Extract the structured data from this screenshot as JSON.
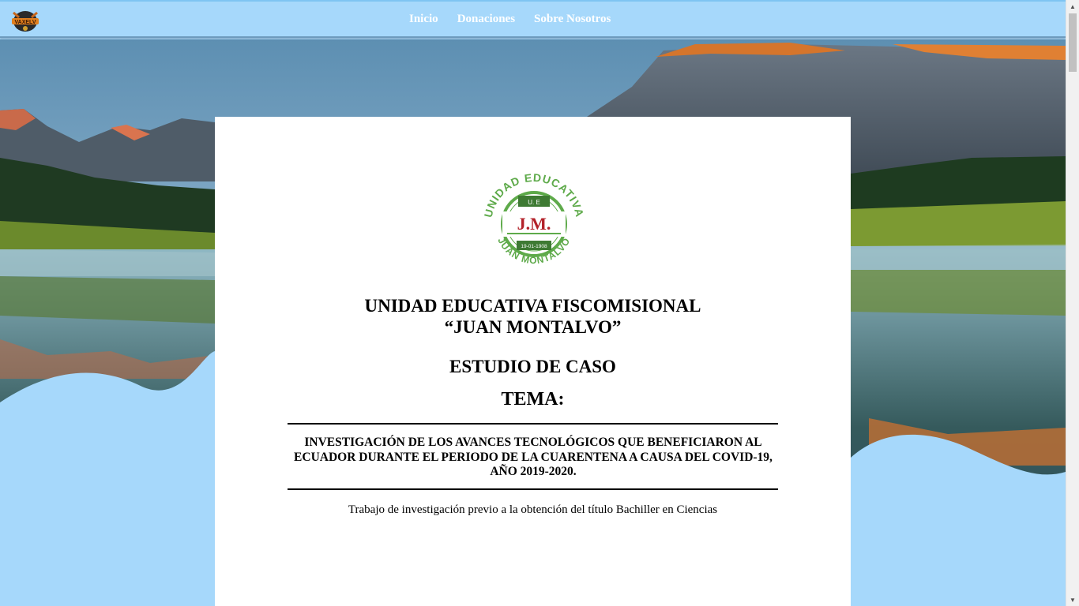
{
  "nav": {
    "logo_icon": "vaxelv-logo-icon",
    "links": [
      "Inicio",
      "Donaciones",
      "Sobre Nosotros"
    ]
  },
  "seal": {
    "top_text": "UNIDAD EDUCATIVA",
    "bottom_text": "JUAN MONTALVO",
    "initials": "J.M.",
    "badge": "U. E",
    "date": "19-01-1908"
  },
  "document": {
    "school_line1": "UNIDAD EDUCATIVA FISCOMISIONAL",
    "school_line2": "“JUAN MONTALVO”",
    "doc_type": "ESTUDIO DE CASO",
    "tema_label": "TEMA:",
    "topic_line1": "INVESTIGACIÓN DE LOS AVANCES TECNOLÓGICOS QUE BENEFICIARON AL",
    "topic_line2": "ECUADOR DURANTE EL PERIODO DE LA CUARENTENA A CAUSA DEL COVID-19,",
    "topic_line3": "AÑO 2019-2020.",
    "subtitle": "Trabajo de investigación previo a la obtención del título Bachiller en Ciencias"
  },
  "colors": {
    "navbar": "#a6d8fb",
    "sky": "#a6d8fb",
    "seal_green": "#5eaa4a",
    "seal_red": "#b3222a"
  }
}
